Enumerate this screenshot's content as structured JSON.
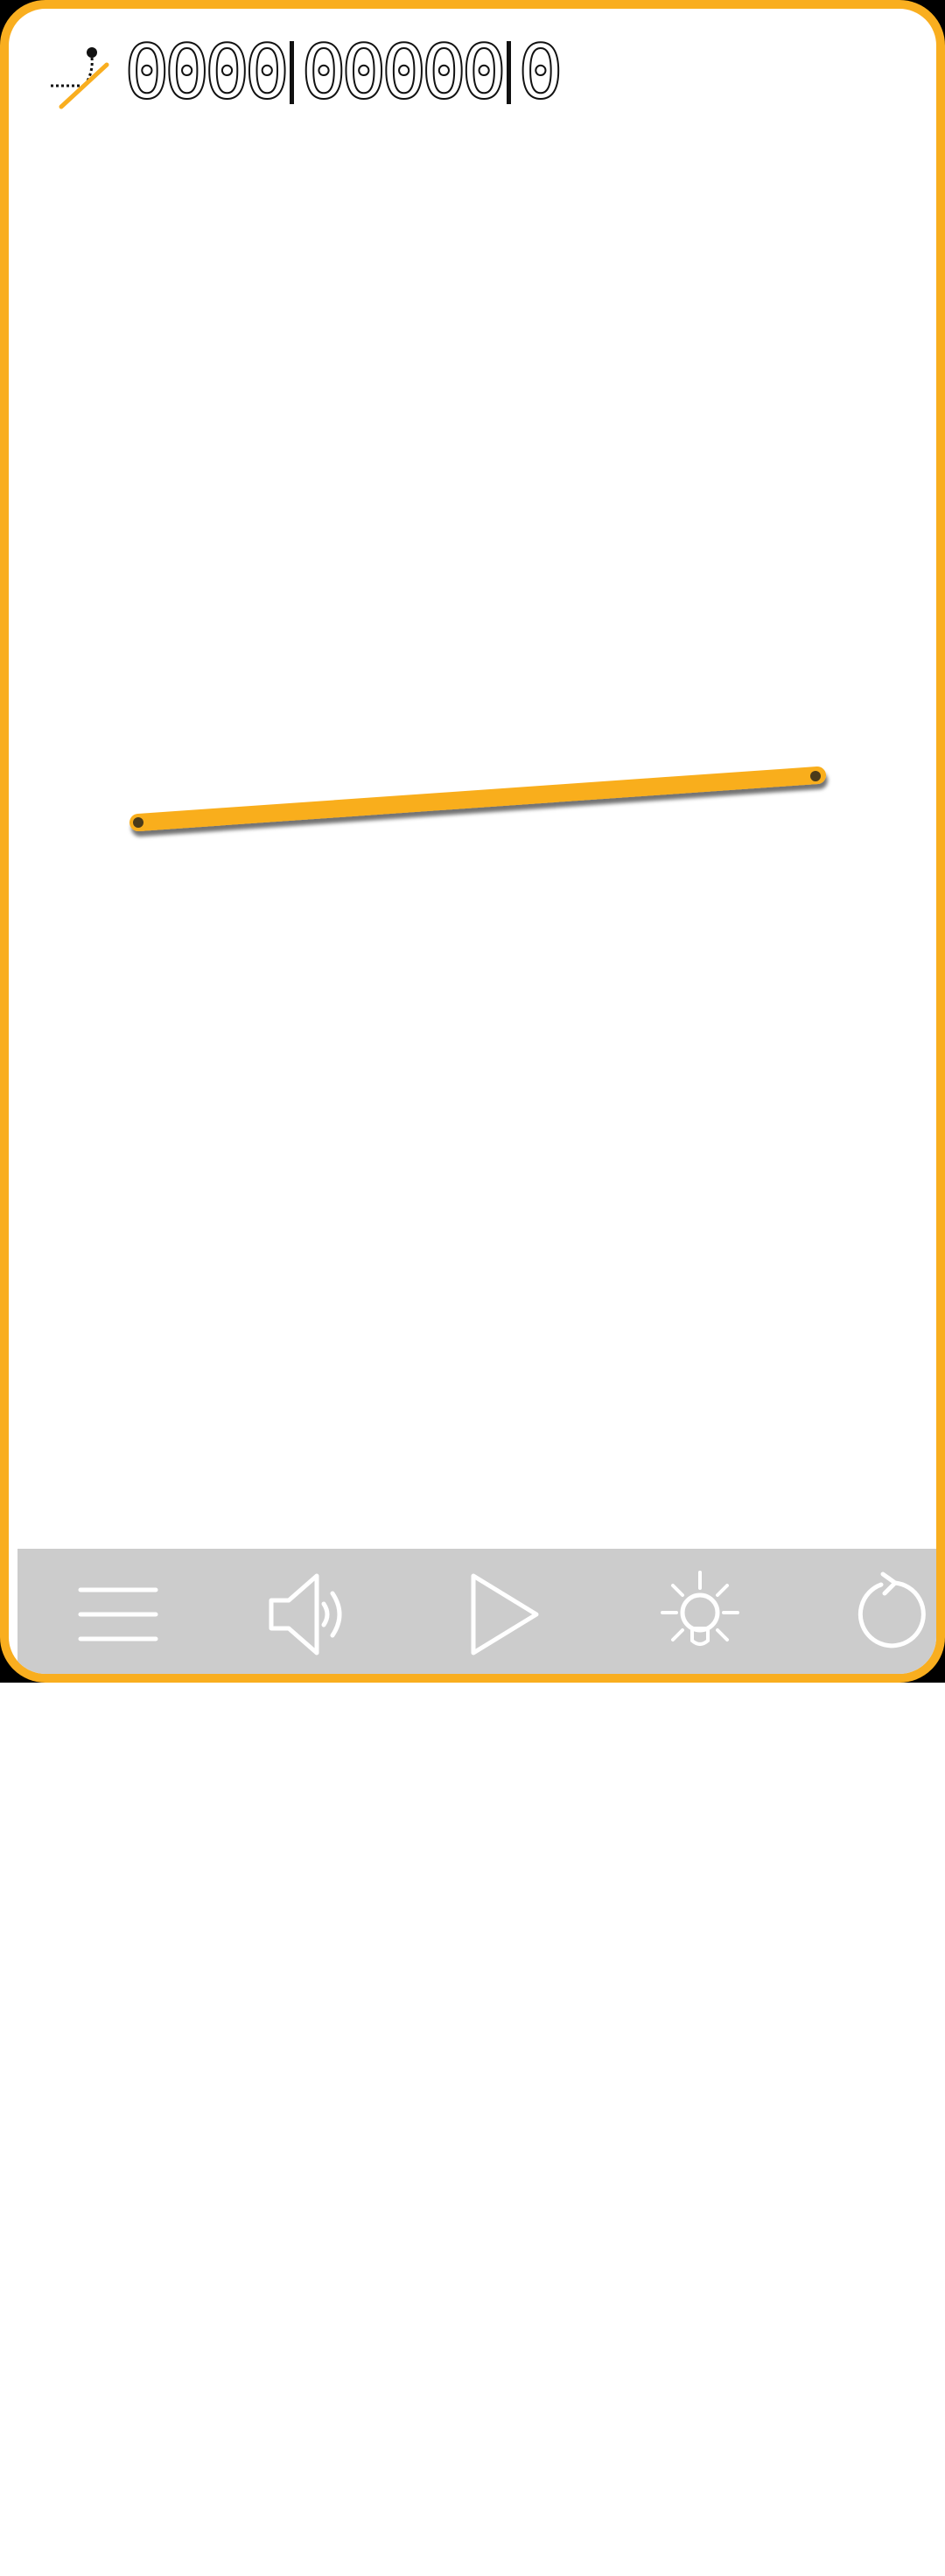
{
  "hud": {
    "level_icon": "ball-drop-line-icon",
    "digit_groups": [
      [
        "0",
        "0",
        "0",
        "0"
      ],
      [
        "0",
        "0",
        "0",
        "0",
        "0"
      ],
      [
        "0"
      ]
    ]
  },
  "colors": {
    "accent": "#F9AE1F",
    "toolbar": "#CCCCCC",
    "frame_outer": "#000000",
    "pivot": "#4A3A1A"
  },
  "toolbar": {
    "buttons": [
      {
        "name": "menu-button",
        "icon": "hamburger-menu-icon"
      },
      {
        "name": "sound-button",
        "icon": "speaker-icon"
      },
      {
        "name": "play-button",
        "icon": "play-icon"
      },
      {
        "name": "hint-button",
        "icon": "lightbulb-icon"
      },
      {
        "name": "restart-button",
        "icon": "restart-icon"
      }
    ]
  }
}
